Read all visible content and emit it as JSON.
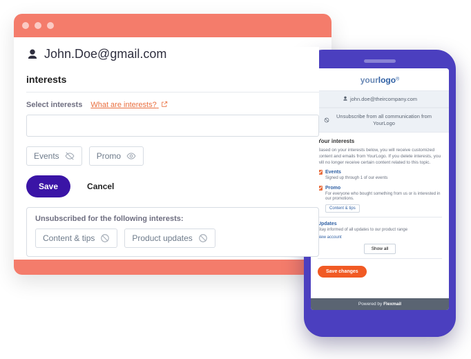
{
  "browser": {
    "email": "John.Doe@gmail.com",
    "section_title": "interests",
    "select_label": "Select interests",
    "help_link": "What are interests?",
    "chips_active": [
      "Events",
      "Promo"
    ],
    "save": "Save",
    "cancel": "Cancel",
    "unsub_title": "Unsubscribed for the following interests:",
    "chips_unsub": [
      "Content & tips",
      "Product updates"
    ]
  },
  "phone": {
    "logo_a": "your",
    "logo_b": "logo",
    "email": "john.doe@theircompany.com",
    "unsub_all": "Unsubscribe from all communication from YourLogo",
    "interests_title": "Your interests",
    "interests_desc": "Based on your interests below, you will receive customized content and emails from YourLogo. If you delete interests, you will no longer receive certain content related to this topic.",
    "items": [
      {
        "name": "Events",
        "desc": "Signed up through 1 of our events"
      },
      {
        "name": "Promo",
        "desc": "For everyone who bought something from us or is interested in our promotions.",
        "sub": "Content & tips"
      },
      {
        "name": "Updates",
        "desc": "Stay informed of all updates to our product range",
        "link": "New account"
      }
    ],
    "show_all": "Show all",
    "save_changes": "Save changes",
    "powered": "Powered by",
    "powered_brand": "Flexmail"
  }
}
